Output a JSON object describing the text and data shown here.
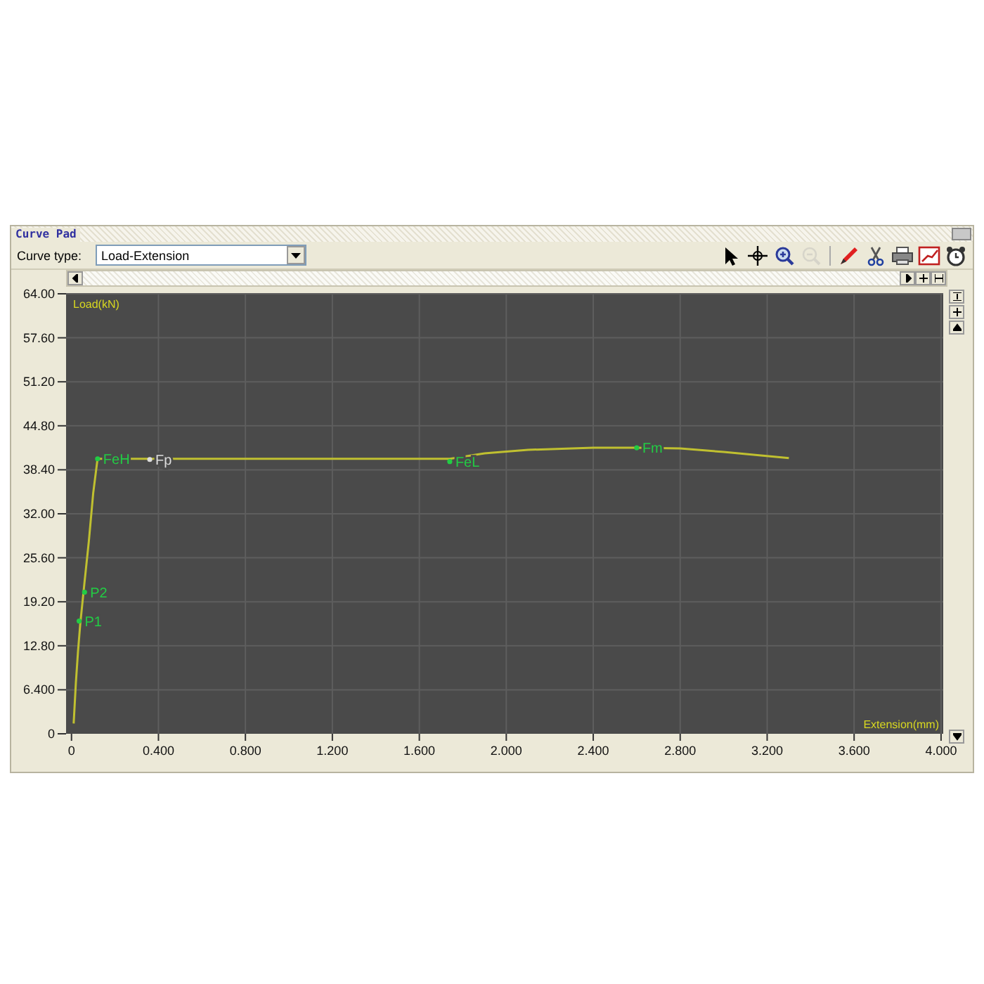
{
  "panel": {
    "title": "Curve Pad"
  },
  "toolbar": {
    "label": "Curve type:",
    "curve_type": "Load-Extension",
    "tools": [
      {
        "kind": "pointer",
        "disabled": false
      },
      {
        "kind": "crosshair",
        "disabled": false
      },
      {
        "kind": "zoom-in",
        "disabled": false
      },
      {
        "kind": "zoom-out",
        "disabled": true
      },
      {
        "kind": "separator",
        "disabled": false
      },
      {
        "kind": "pencil",
        "disabled": false
      },
      {
        "kind": "scissors",
        "disabled": false
      },
      {
        "kind": "printer",
        "disabled": false
      },
      {
        "kind": "chart",
        "disabled": false
      },
      {
        "kind": "clock",
        "disabled": false
      }
    ]
  },
  "chart": {
    "chart_data": {
      "type": "line",
      "xlabel": "Extension(mm)",
      "ylabel": "Load(kN)",
      "x": [
        0.01,
        0.02,
        0.03,
        0.04,
        0.05,
        0.06,
        0.08,
        0.1,
        0.12,
        0.4,
        1.0,
        1.74,
        1.9,
        2.1,
        2.4,
        2.6,
        2.8,
        3.0,
        3.3
      ],
      "series": [
        {
          "color": "#c0c030",
          "values": [
            1.5,
            7.5,
            12,
            16,
            19,
            22,
            28,
            35,
            40,
            40,
            40,
            40,
            40.8,
            41.3,
            41.6,
            41.6,
            41.5,
            41,
            40.1
          ]
        }
      ],
      "xlim": [
        -0.025,
        4.01
      ],
      "ylim": [
        0,
        64
      ],
      "grid": true,
      "xticks": [
        {
          "value": 0,
          "label": "0"
        },
        {
          "value": 0.4,
          "label": "0.400"
        },
        {
          "value": 0.8,
          "label": "0.800"
        },
        {
          "value": 1.2,
          "label": "1.200"
        },
        {
          "value": 1.6,
          "label": "1.600"
        },
        {
          "value": 2.0,
          "label": "2.000"
        },
        {
          "value": 2.4,
          "label": "2.400"
        },
        {
          "value": 2.8,
          "label": "2.800"
        },
        {
          "value": 3.2,
          "label": "3.200"
        },
        {
          "value": 3.6,
          "label": "3.600"
        },
        {
          "value": 4.0,
          "label": "4.000"
        }
      ],
      "yticks": [
        {
          "value": 0,
          "label": "0"
        },
        {
          "value": 6.4,
          "label": "6.400"
        },
        {
          "value": 12.8,
          "label": "12.80"
        },
        {
          "value": 19.2,
          "label": "19.20"
        },
        {
          "value": 25.6,
          "label": "25.60"
        },
        {
          "value": 32,
          "label": "32.00"
        },
        {
          "value": 38.4,
          "label": "38.40"
        },
        {
          "value": 44.8,
          "label": "44.80"
        },
        {
          "value": 51.2,
          "label": "51.20"
        },
        {
          "value": 57.6,
          "label": "57.60"
        },
        {
          "value": 64,
          "label": "64.00"
        }
      ],
      "annotations": [
        {
          "text": "P1",
          "x": 0.035,
          "y": 16.4
        },
        {
          "text": "P2",
          "x": 0.06,
          "y": 20.6
        },
        {
          "text": "FeH",
          "x": 0.12,
          "y": 40
        },
        {
          "text": "Fp",
          "x": 0.36,
          "y": 39.9
        },
        {
          "text": "FeL",
          "x": 1.74,
          "y": 39.6
        },
        {
          "text": "Fm",
          "x": 2.6,
          "y": 41.6
        }
      ]
    },
    "annotation_styles": [
      {
        "color": "#22cc44"
      },
      {
        "color": "#22cc44"
      },
      {
        "color": "#22cc44"
      },
      {
        "color": "#dddddd"
      },
      {
        "color": "#22cc44"
      },
      {
        "color": "#22cc44"
      }
    ]
  }
}
